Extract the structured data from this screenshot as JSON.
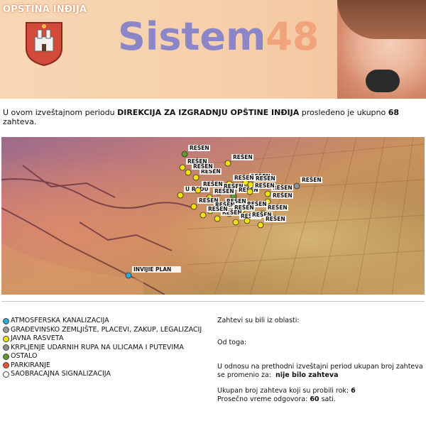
{
  "header": {
    "municipality": "OPŠTINA INĐIJA",
    "logo_part1": "Sistem",
    "logo_part2": "48"
  },
  "intro": {
    "prefix": "U ovom izveštajnom periodu ",
    "directorate": "DIREKCIJA ZA IZGRADNJU OPŠTINE INĐIJA",
    "middle": " prosleđeno je ukupno ",
    "count": "68",
    "suffix": "zahteva."
  },
  "map": {
    "markers": [
      {
        "status": "REŠEN",
        "color": "#5a9a2a"
      },
      {
        "status": "REŠEN",
        "color": "#f1e10c"
      },
      {
        "status": "REŠEN",
        "color": "#f1e10c"
      },
      {
        "status": "REŠEN",
        "color": "#f1e10c"
      },
      {
        "status": "REŠEN",
        "color": "#f1e10c"
      },
      {
        "status": "REŠEN",
        "color": "#f1e10c"
      },
      {
        "status": "REŠEN",
        "color": "#f1e10c"
      },
      {
        "status": "REŠEN",
        "color": "#f1e10c"
      },
      {
        "status": "REŠEN",
        "color": "#8f8f8f"
      },
      {
        "status": "U RADU",
        "color": "#f1e10c"
      },
      {
        "status": "REŠEN",
        "color": "#f1e10c"
      },
      {
        "status": "REŠEN",
        "color": "#f1e10c"
      },
      {
        "status": "REŠEN",
        "color": "#5a9a2a"
      },
      {
        "status": "REŠEN",
        "color": "#f1e10c"
      },
      {
        "status": "REŠEN",
        "color": "#f1e10c"
      },
      {
        "status": "REŠEN",
        "color": "#f1e10c"
      },
      {
        "status": "REŠEN",
        "color": "#f1e10c"
      },
      {
        "status": "REŠEN",
        "color": "#f1e10c"
      },
      {
        "status": "REŠEN",
        "color": "#f1e10c"
      },
      {
        "status": "REŠEN",
        "color": "#f1e10c"
      },
      {
        "status": "REŠEN",
        "color": "#f1e10c"
      },
      {
        "status": "REŠEN",
        "color": "#f1e10c"
      },
      {
        "status": "REŠEN",
        "color": "#f1e10c"
      },
      {
        "status": "REŠEN",
        "color": "#f1e10c"
      },
      {
        "status": "REŠEN",
        "color": "#f1e10c"
      },
      {
        "status": "REŠEN",
        "color": "#f1e10c"
      },
      {
        "status": "REŠEN",
        "color": "#f1e10c"
      },
      {
        "status": "REŠEN",
        "color": "#f1e10c"
      },
      {
        "status": "INVIJIE PLAN",
        "color": "#29a8d9"
      }
    ]
  },
  "legend": {
    "items": [
      {
        "label": "ATMOSFERSKA KANALIZACIJA",
        "color": "#29a8d9"
      },
      {
        "label": "GRAĐEVINSKO ZEMLJIŠTE, PLACEVI, ZAKUP, LEGALIZACIJ",
        "color": "#9a9a9a"
      },
      {
        "label": "JAVNA RASVETA",
        "color": "#f1e10c"
      },
      {
        "label": "KRPLJENJE UDARNIH RUPA NA ULICAMA I PUTEVIMA",
        "color": "#8f8f8f"
      },
      {
        "label": "OSTALO",
        "color": "#5a9a2a"
      },
      {
        "label": "PARKIRANJE",
        "color": "#e4572e"
      },
      {
        "label": "SAOBRACAJNA SIGNALIZACIJA",
        "color": "#ffffff"
      }
    ]
  },
  "stats": {
    "areas_label": "Zahtevi su bili iz oblasti:",
    "of_which_label": "Od toga:",
    "change_text": "U odnosu na prethodni izveštajni period ukupan broj zahteva se promenio za:",
    "change_value": "nije bilo zahteva",
    "deadline_text": "Ukupan broj zahteva koji su probili rok:",
    "deadline_value": "6",
    "avg_text": "Prosečno vreme odgovora:",
    "avg_value": "60",
    "avg_unit": "sati."
  }
}
